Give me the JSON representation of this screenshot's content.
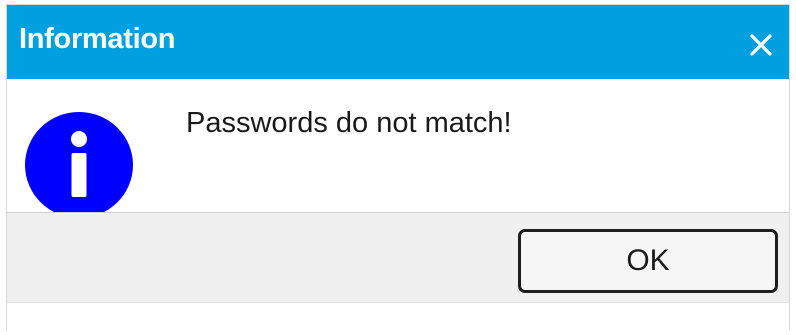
{
  "dialog": {
    "title": "Information",
    "message": "Passwords do not match!",
    "ok_label": "OK",
    "close_icon": "close-icon",
    "status_icon": "info-icon"
  },
  "colors": {
    "titlebar": "#009fdd",
    "info_icon": "#0000ff",
    "footer": "#f0f0f0"
  }
}
